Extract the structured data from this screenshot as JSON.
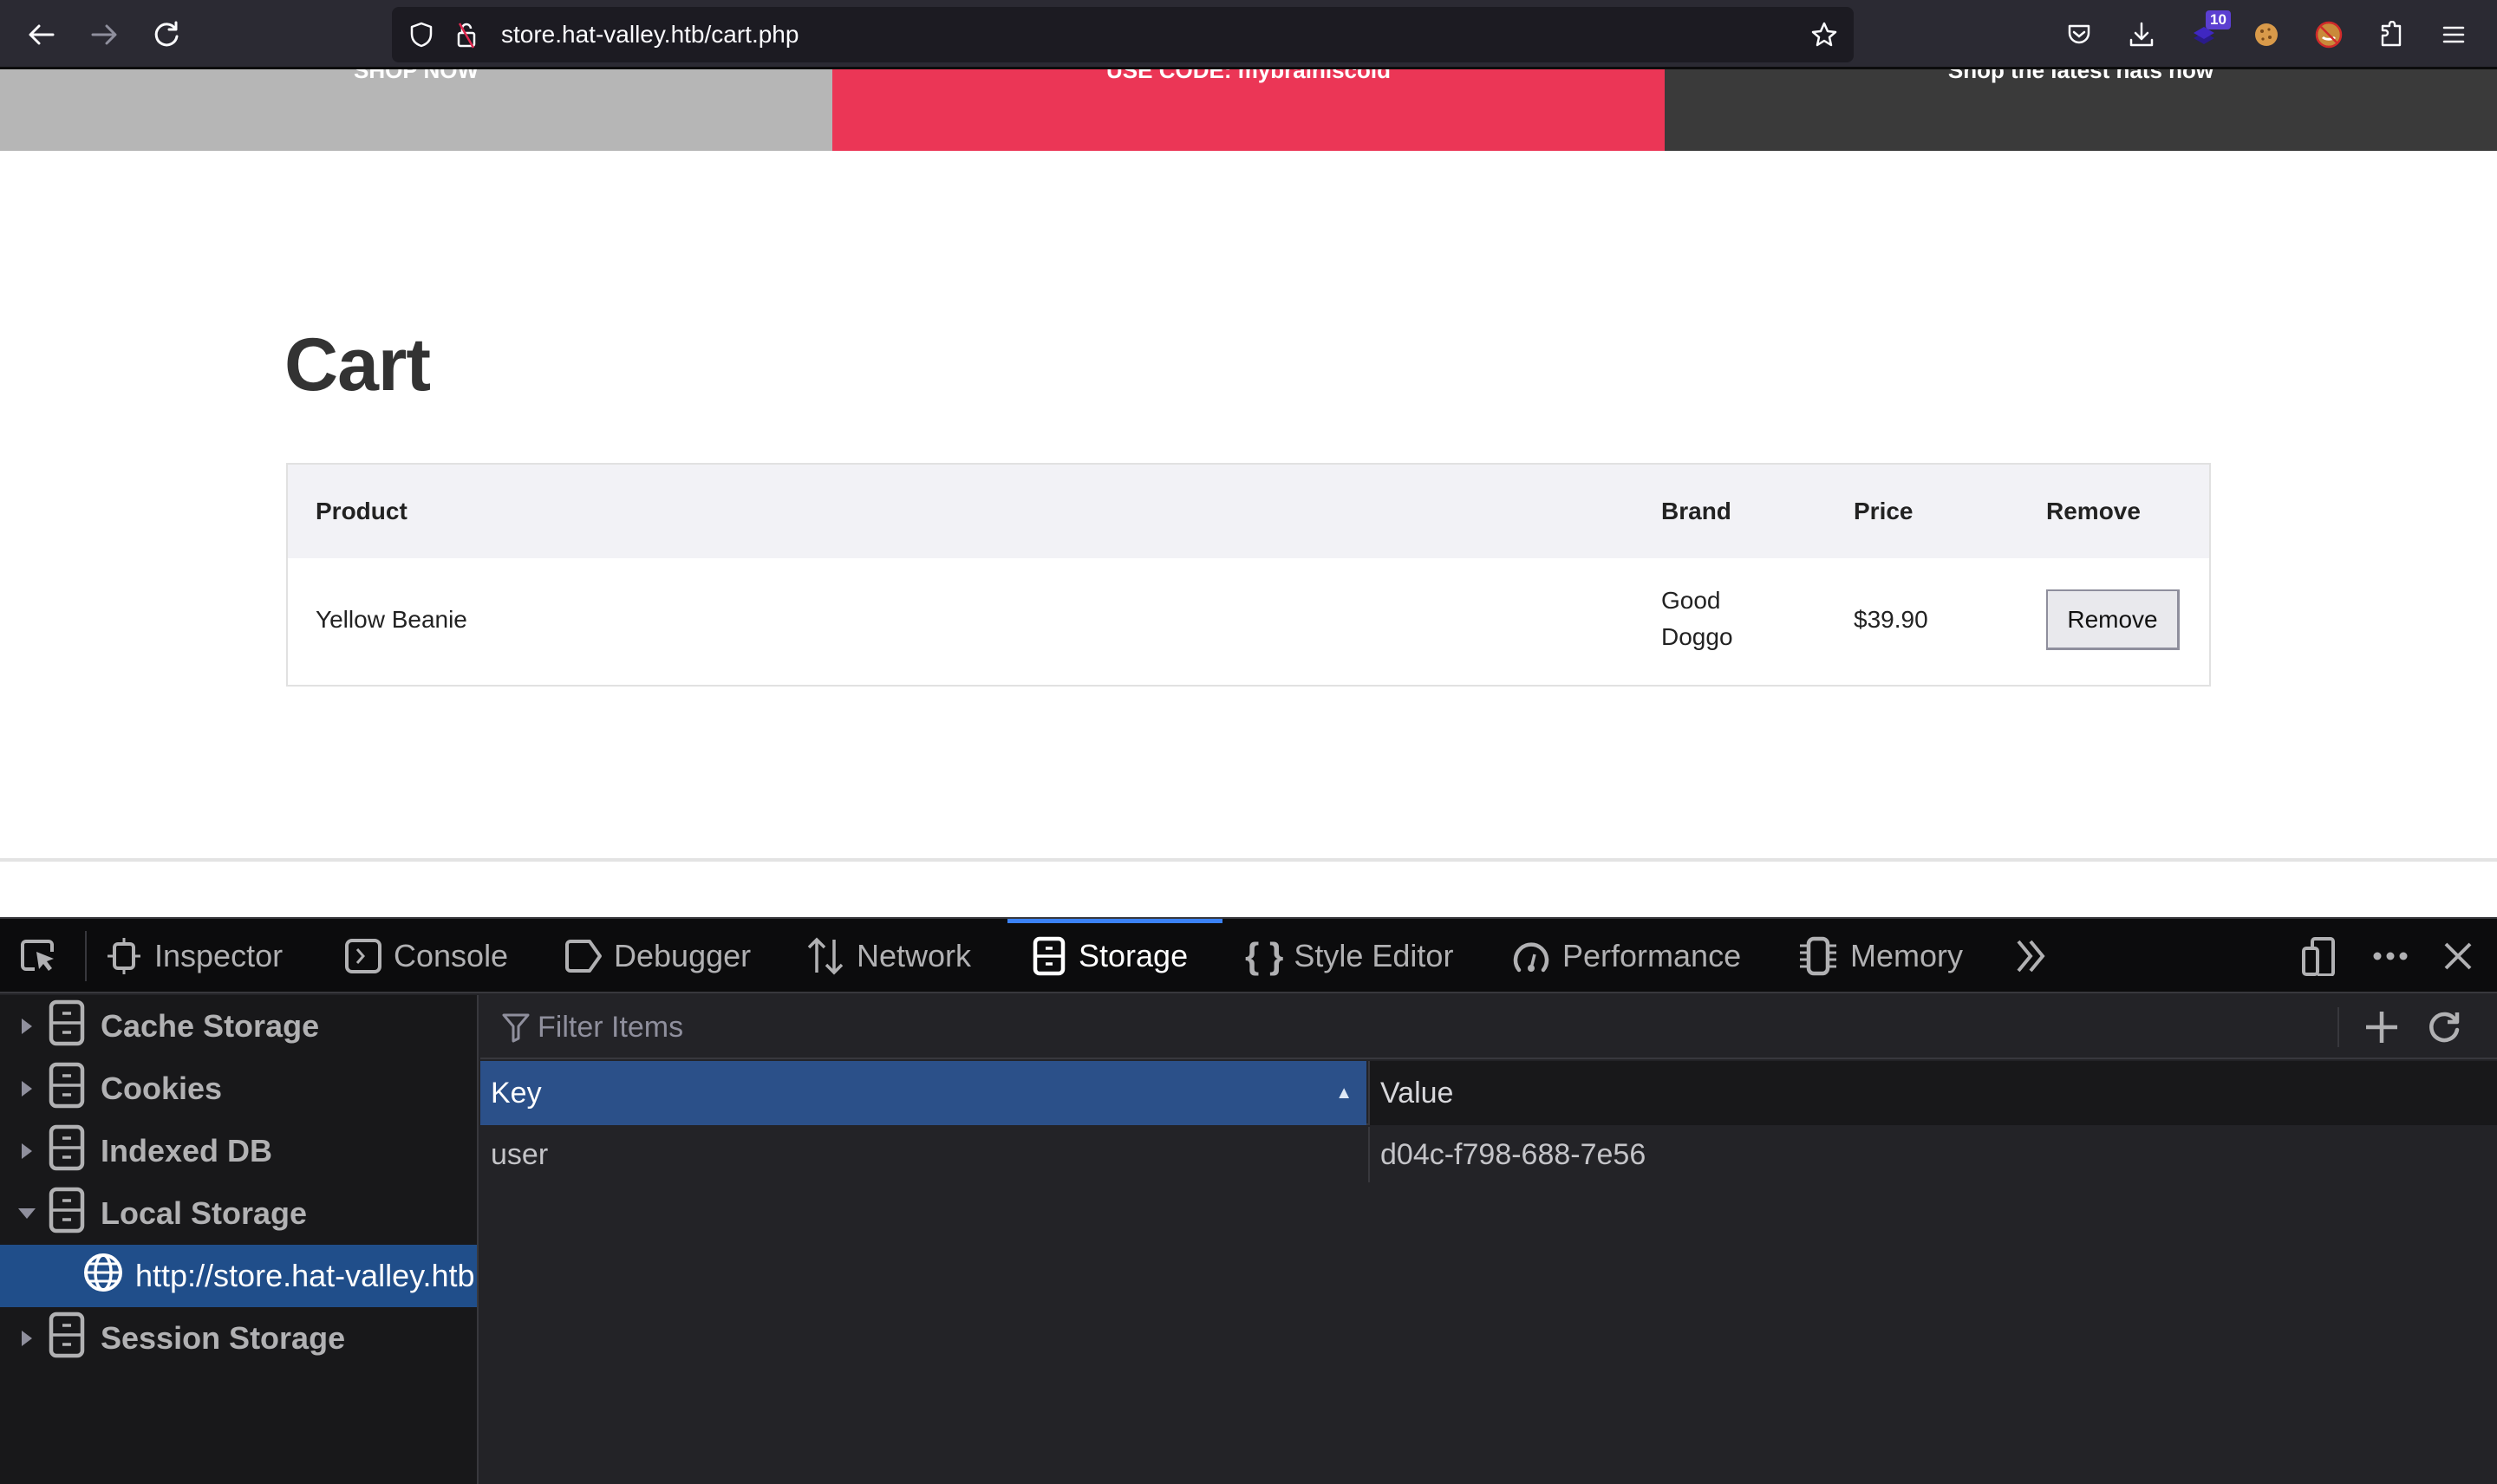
{
  "browser": {
    "url": "store.hat-valley.htb/cart.php",
    "extension_badge": "10",
    "icons": [
      "back-icon",
      "forward-icon",
      "reload-icon",
      "shield-icon",
      "insecure-lock-icon",
      "bookmark-star-icon",
      "pocket-icon",
      "download-icon",
      "extension-stack-icon",
      "cookie-icon",
      "blocked-fox-icon",
      "extensions-puzzle-icon",
      "menu-icon"
    ]
  },
  "page": {
    "banner": [
      {
        "text": "SHOP NOW",
        "color": "#b6b6b6"
      },
      {
        "text": "USE CODE: mybrainiscold",
        "color": "#eb3656"
      },
      {
        "text": "Shop the latest hats now",
        "color": "#3a3a3a"
      }
    ],
    "title": "Cart",
    "table": {
      "headers": {
        "product": "Product",
        "brand": "Brand",
        "price": "Price",
        "remove": "Remove"
      },
      "rows": [
        {
          "product": "Yellow Beanie",
          "brand_line1": "Good",
          "brand_line2": "Doggo",
          "price": "$39.90",
          "remove_label": "Remove"
        }
      ]
    }
  },
  "devtools": {
    "tabs": [
      {
        "label": "Inspector",
        "icon": "inspector-icon"
      },
      {
        "label": "Console",
        "icon": "console-icon"
      },
      {
        "label": "Debugger",
        "icon": "debugger-icon"
      },
      {
        "label": "Network",
        "icon": "network-icon"
      },
      {
        "label": "Storage",
        "icon": "storage-icon",
        "active": true
      },
      {
        "label": "Style Editor",
        "icon": "style-editor-icon"
      },
      {
        "label": "Performance",
        "icon": "performance-icon"
      },
      {
        "label": "Memory",
        "icon": "memory-icon"
      }
    ],
    "accent_color": "#3b82f6",
    "sidebar": [
      {
        "label": "Cache Storage",
        "expanded": false
      },
      {
        "label": "Cookies",
        "expanded": false
      },
      {
        "label": "Indexed DB",
        "expanded": false
      },
      {
        "label": "Local Storage",
        "expanded": true
      },
      {
        "label": "http://store.hat-valley.htb",
        "selected": true
      },
      {
        "label": "Session Storage",
        "expanded": false
      }
    ],
    "filter_placeholder": "Filter Items",
    "grid": {
      "headers": {
        "key": "Key",
        "value": "Value"
      },
      "sorted_column": "Key",
      "sort_direction": "ascending",
      "rows": [
        {
          "key": "user",
          "value": "d04c-f798-688-7e56"
        }
      ]
    }
  }
}
